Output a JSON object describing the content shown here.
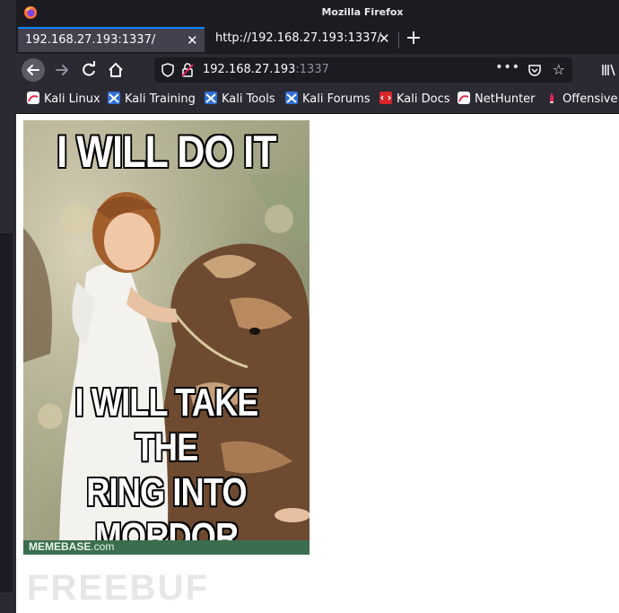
{
  "window": {
    "title": "Mozilla Firefox"
  },
  "tabs": [
    {
      "label": "192.168.27.193:1337/",
      "active": true
    },
    {
      "label": "http://192.168.27.193:1337/",
      "active": false
    }
  ],
  "navbar": {
    "url_host": "192.168.27.193",
    "url_port": ":1337",
    "icons": [
      "back-arrow-icon",
      "forward-arrow-icon",
      "reload-icon",
      "home-icon",
      "shield-icon",
      "insecure-lock-icon",
      "more-icon",
      "pocket-icon",
      "star-icon",
      "library-icon"
    ]
  },
  "bookmarks": [
    {
      "label": "Kali Linux",
      "icon": "kali-icon"
    },
    {
      "label": "Kali Training",
      "icon": "kali-training-icon"
    },
    {
      "label": "Kali Tools",
      "icon": "kali-tools-icon"
    },
    {
      "label": "Kali Forums",
      "icon": "kali-forums-icon"
    },
    {
      "label": "Kali Docs",
      "icon": "kali-docs-icon"
    },
    {
      "label": "NetHunter",
      "icon": "nethunter-icon"
    },
    {
      "label": "Offensive S",
      "icon": "offsec-icon"
    }
  ],
  "meme": {
    "top_text": "I WILL DO IT",
    "bottom_line1": "I WILL TAKE THE",
    "bottom_line2": "RING INTO",
    "bottom_line3": "MORDOR",
    "footer_brand": "MEMEBASE",
    "footer_domain": ".com"
  },
  "watermark": "FREEBUF",
  "colors": {
    "titlebar": "#1c1b22",
    "toolbar": "#2b2a33",
    "active_tab": "#42414d",
    "accent": "#0a84ff"
  }
}
